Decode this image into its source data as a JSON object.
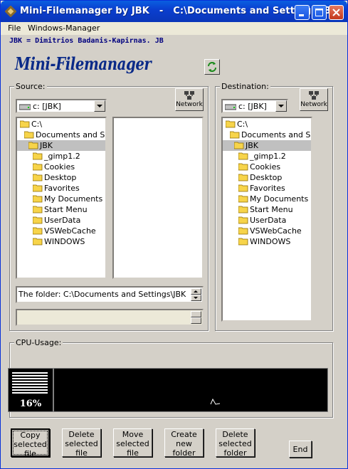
{
  "window": {
    "title": "Mini-Filemanager by JBK   -   C:\\Documents and Settings\\JBK",
    "minimize_icon": "minimize-icon",
    "maximize_icon": "maximize-icon",
    "close_icon": "close-icon"
  },
  "menu": {
    "items": [
      {
        "label": "File"
      },
      {
        "label": "Windows-Manager"
      }
    ]
  },
  "header": {
    "author": "JBK = Dimitrios Badanis-Kapirnas. JB",
    "logo": "Mini-Filemanager",
    "refresh_icon": "refresh-icon"
  },
  "source": {
    "label": "Source:",
    "network_label": "Network",
    "drive": "c: [JBK]",
    "folders": [
      {
        "label": "C:\\",
        "indent": 0,
        "selected": false
      },
      {
        "label": "Documents and Settings",
        "indent": 1,
        "selected": false
      },
      {
        "label": "JBK",
        "indent": 2,
        "selected": true
      },
      {
        "label": "_gimp1.2",
        "indent": 3,
        "selected": false
      },
      {
        "label": "Cookies",
        "indent": 3,
        "selected": false
      },
      {
        "label": "Desktop",
        "indent": 3,
        "selected": false
      },
      {
        "label": "Favorites",
        "indent": 3,
        "selected": false
      },
      {
        "label": "My Documents",
        "indent": 3,
        "selected": false
      },
      {
        "label": "Start Menu",
        "indent": 3,
        "selected": false
      },
      {
        "label": "UserData",
        "indent": 3,
        "selected": false
      },
      {
        "label": "VSWebCache",
        "indent": 3,
        "selected": false
      },
      {
        "label": "WINDOWS",
        "indent": 3,
        "selected": false
      }
    ],
    "folder_info": "The folder: C:\\Documents and Settings\\JBK",
    "second_field": ""
  },
  "destination": {
    "label": "Destination:",
    "network_label": "Network",
    "drive": "c: [JBK]",
    "folders": [
      {
        "label": "C:\\",
        "indent": 0,
        "selected": false
      },
      {
        "label": "Documents and Settings",
        "indent": 1,
        "selected": false
      },
      {
        "label": "JBK",
        "indent": 2,
        "selected": true
      },
      {
        "label": "_gimp1.2",
        "indent": 3,
        "selected": false
      },
      {
        "label": "Cookies",
        "indent": 3,
        "selected": false
      },
      {
        "label": "Desktop",
        "indent": 3,
        "selected": false
      },
      {
        "label": "Favorites",
        "indent": 3,
        "selected": false
      },
      {
        "label": "My Documents",
        "indent": 3,
        "selected": false
      },
      {
        "label": "Start Menu",
        "indent": 3,
        "selected": false
      },
      {
        "label": "UserData",
        "indent": 3,
        "selected": false
      },
      {
        "label": "VSWebCache",
        "indent": 3,
        "selected": false
      },
      {
        "label": "WINDOWS",
        "indent": 3,
        "selected": false
      }
    ]
  },
  "cpu": {
    "label": "CPU-Usage:",
    "percent_text": "16%",
    "percent_value": 16
  },
  "buttons": {
    "copy": "Copy selected file",
    "delete_file": "Delete selected file",
    "move": "Move selected file",
    "create_folder": "Create new folder",
    "delete_folder": "Delete selected folder",
    "end": "End"
  },
  "colors": {
    "title_bar": "#0a4fd8",
    "logo": "#0a2a88",
    "author": "#00007f",
    "selected_row": "#c0c0c0",
    "folder": "#f7d44a"
  }
}
